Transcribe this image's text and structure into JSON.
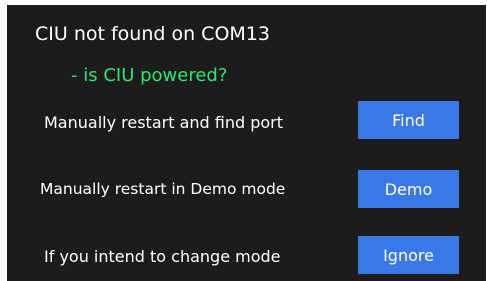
{
  "dialog": {
    "title": "CIU not found on COM13",
    "subtitle": "- is CIU powered?"
  },
  "rows": [
    {
      "label": "Manually restart and find port",
      "button": "Find"
    },
    {
      "label": "Manually restart in Demo mode",
      "button": "Demo"
    },
    {
      "label": "If you intend to change mode",
      "button": "Ignore"
    }
  ],
  "colors": {
    "background": "#1c1c1c",
    "accent": "#3b78e7",
    "subtitle": "#2ee86b"
  }
}
